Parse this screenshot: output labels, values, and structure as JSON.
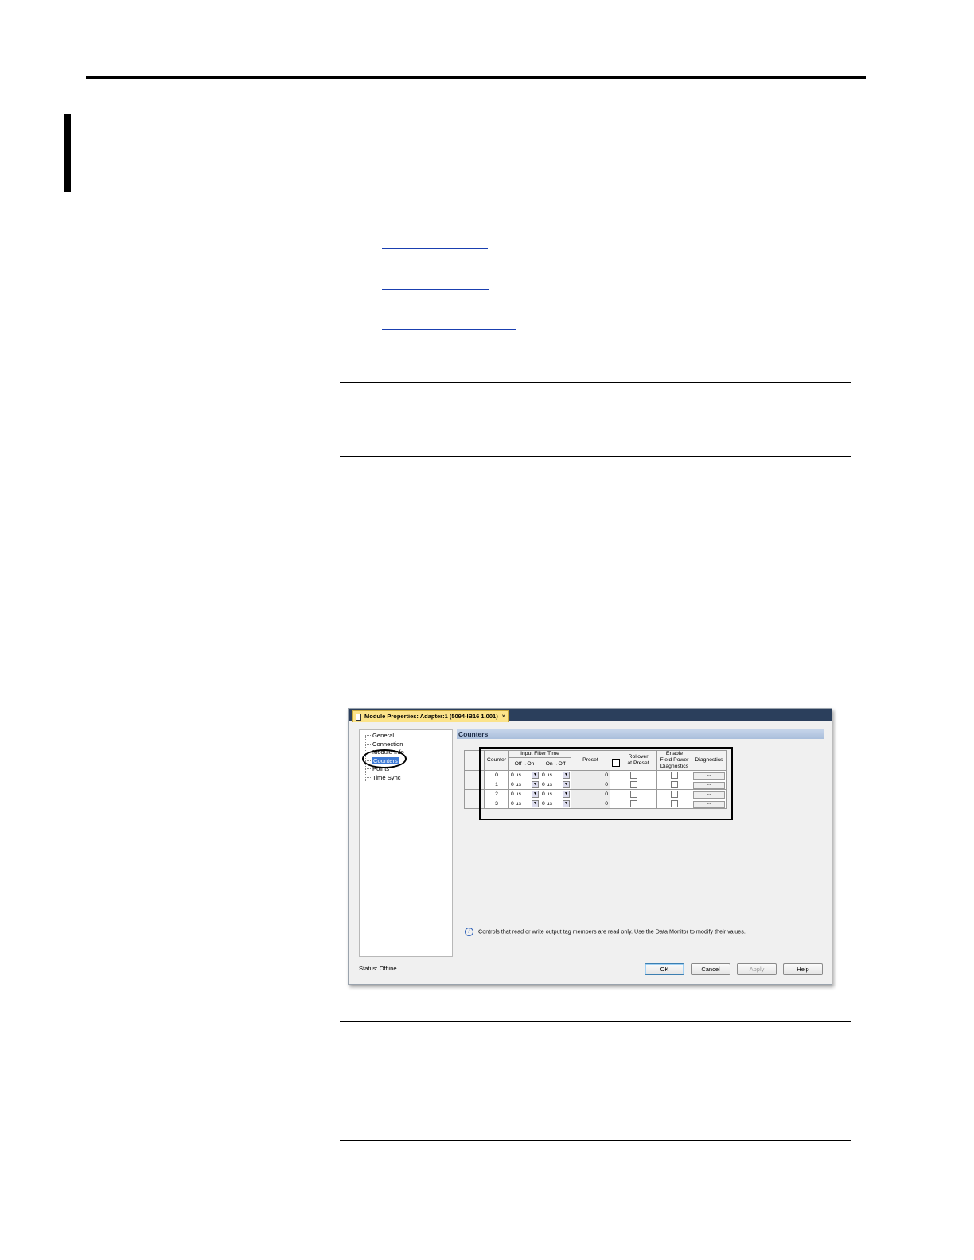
{
  "links": [
    "",
    "",
    "",
    ""
  ],
  "dialog": {
    "title": "Module Properties: Adapter:1 (5094-IB16 1.001)",
    "close_glyph": "×",
    "tree": [
      "General",
      "Connection",
      "Module Info",
      "Counters",
      "Points",
      "Time Sync"
    ],
    "selected_tree_item": "Counters",
    "section_title": "Counters",
    "table": {
      "col_counter": "Counter",
      "col_input_filter_time": "Input Filter Time",
      "col_off_on": "Off→On",
      "col_on_off": "On→Off",
      "col_preset": "Preset",
      "col_rollover_line1": "Rollover",
      "col_rollover_line2": "at Preset",
      "col_enable_line1": "Enable",
      "col_enable_line2": "Field Power",
      "col_enable_line3": "Diagnostics",
      "col_diagnostics": "Diagnostics",
      "rows": [
        {
          "counter": "0",
          "off_on": "0 µs",
          "on_off": "0 µs",
          "preset": "0",
          "diag": "..."
        },
        {
          "counter": "1",
          "off_on": "0 µs",
          "on_off": "0 µs",
          "preset": "0",
          "diag": "..."
        },
        {
          "counter": "2",
          "off_on": "0 µs",
          "on_off": "0 µs",
          "preset": "0",
          "diag": "..."
        },
        {
          "counter": "3",
          "off_on": "0 µs",
          "on_off": "0 µs",
          "preset": "0",
          "diag": "..."
        }
      ]
    },
    "info_text": "Controls that read or write output tag members are read only. Use the Data Monitor to modify their values.",
    "status": "Status:  Offline",
    "buttons": {
      "ok": "OK",
      "cancel": "Cancel",
      "apply": "Apply",
      "help": "Help"
    }
  }
}
